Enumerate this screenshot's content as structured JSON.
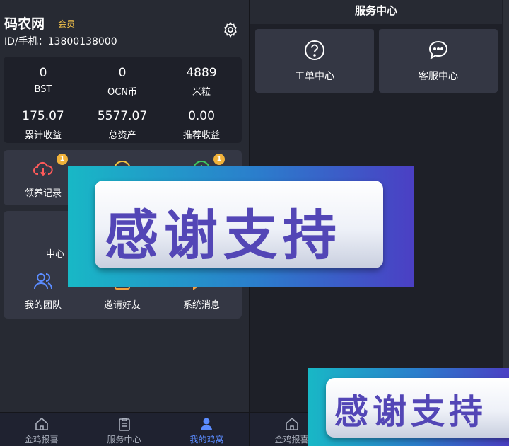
{
  "left": {
    "user": {
      "name": "码农网",
      "badge": "会员",
      "id_line": "ID/手机：13800138000"
    },
    "stats": [
      {
        "value": "0",
        "label": "BST"
      },
      {
        "value": "0",
        "label": "OCN币"
      },
      {
        "value": "4889",
        "label": "米粒"
      },
      {
        "value": "175.07",
        "label": "累计收益"
      },
      {
        "value": "5577.07",
        "label": "总资产"
      },
      {
        "value": "0.00",
        "label": "推荐收益"
      }
    ],
    "actions": [
      {
        "label": "领养记录",
        "badge": "1"
      },
      {
        "badge": "1"
      }
    ],
    "menu": [
      {
        "label": "中心"
      },
      {
        "label": "我的团队"
      },
      {
        "label": "邀请好友"
      },
      {
        "label": "系统消息"
      }
    ],
    "tabs": [
      {
        "label": "金鸡报喜"
      },
      {
        "label": "服务中心"
      },
      {
        "label": "我的鸡窝"
      }
    ]
  },
  "right": {
    "title": "服务中心",
    "services": [
      {
        "label": "工单中心"
      },
      {
        "label": "客服中心"
      }
    ],
    "tabs": [
      {
        "label": "金鸡报喜"
      }
    ]
  },
  "banner": {
    "text": "感谢支持",
    "partial_text": "感谢支持"
  },
  "colors": {
    "accent": "#5b8cff",
    "badge": "#f1b23a",
    "member": "#f2c14a",
    "icon_red": "#ff5a5a",
    "icon_yellow": "#f3c63f",
    "icon_green": "#3ec95f",
    "icon_blue": "#5b8cff"
  }
}
